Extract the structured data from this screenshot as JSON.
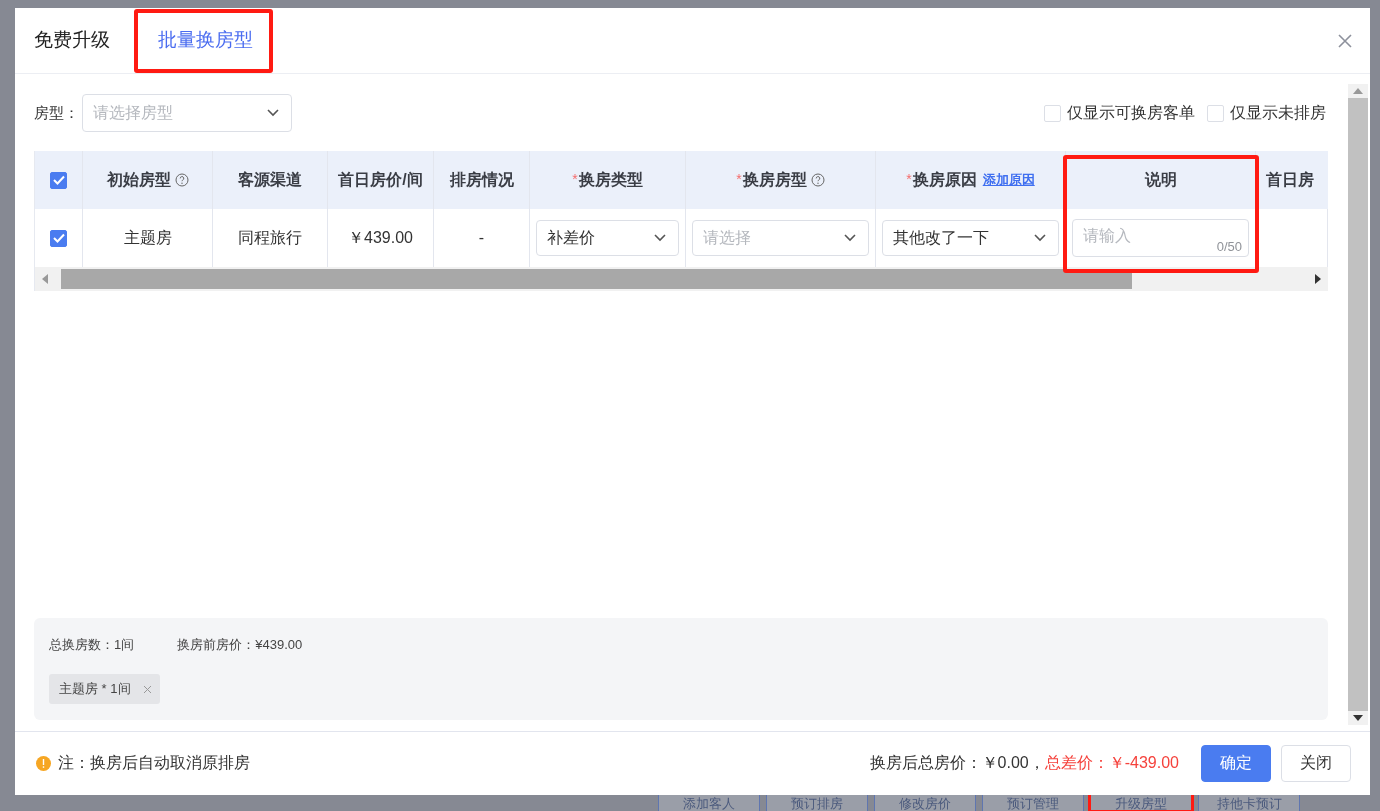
{
  "background_buttons": [
    {
      "label": "添加客人",
      "highlighted": false
    },
    {
      "label": "预订排房",
      "highlighted": false
    },
    {
      "label": "修改房价",
      "highlighted": false
    },
    {
      "label": "预订管理",
      "highlighted": false
    },
    {
      "label": "升级房型",
      "highlighted": true
    },
    {
      "label": "持他卡预订",
      "highlighted": false
    }
  ],
  "dialog": {
    "tabs": [
      {
        "label": "免费升级",
        "selected": false,
        "highlighted": false
      },
      {
        "label": "批量换房型",
        "selected": true,
        "highlighted": true
      }
    ],
    "filter": {
      "label": "房型：",
      "placeholder": "请选择房型"
    },
    "options": [
      {
        "label": "仅显示可换房客单",
        "checked": false
      },
      {
        "label": "仅显示未排房",
        "checked": false
      }
    ],
    "table": {
      "all_checked": true,
      "columns": [
        {
          "label": "初始房型",
          "help": true
        },
        {
          "label": "客源渠道"
        },
        {
          "label": "首日房价/间"
        },
        {
          "label": "排房情况"
        },
        {
          "required_mark": "*",
          "label": "换房类型"
        },
        {
          "required_mark": "*",
          "label": "换房房型",
          "help": true
        },
        {
          "required_mark": "*",
          "label": "换房原因",
          "link": "添加原因"
        },
        {
          "label": "说明",
          "highlighted": true
        },
        {
          "label": "首日房"
        }
      ],
      "rows": [
        {
          "checked": true,
          "cells": [
            {
              "kind": "text",
              "text": "主题房"
            },
            {
              "kind": "text",
              "text": "同程旅行"
            },
            {
              "kind": "text",
              "text": "￥439.00"
            },
            {
              "kind": "text",
              "text": "-"
            },
            {
              "kind": "select",
              "value": "补差价"
            },
            {
              "kind": "select",
              "placeholder": "请选择"
            },
            {
              "kind": "select",
              "value": "其他改了一下"
            },
            {
              "kind": "textarea",
              "placeholder": "请输入",
              "counter": "0/50"
            },
            {
              "kind": "empty"
            }
          ]
        }
      ]
    },
    "summary": {
      "items": [
        "总换房数：1间",
        "换房前房价：¥439.00"
      ],
      "tags": [
        {
          "label": "主题房 * 1间"
        }
      ]
    },
    "footer": {
      "note": "注：换房后自动取消原排房",
      "total": "换房后总房价：￥0.00，",
      "difference": "总差价：￥-439.00",
      "buttons": [
        {
          "label": "确定",
          "kind": "primary"
        },
        {
          "label": "关闭",
          "kind": "default"
        }
      ]
    }
  }
}
